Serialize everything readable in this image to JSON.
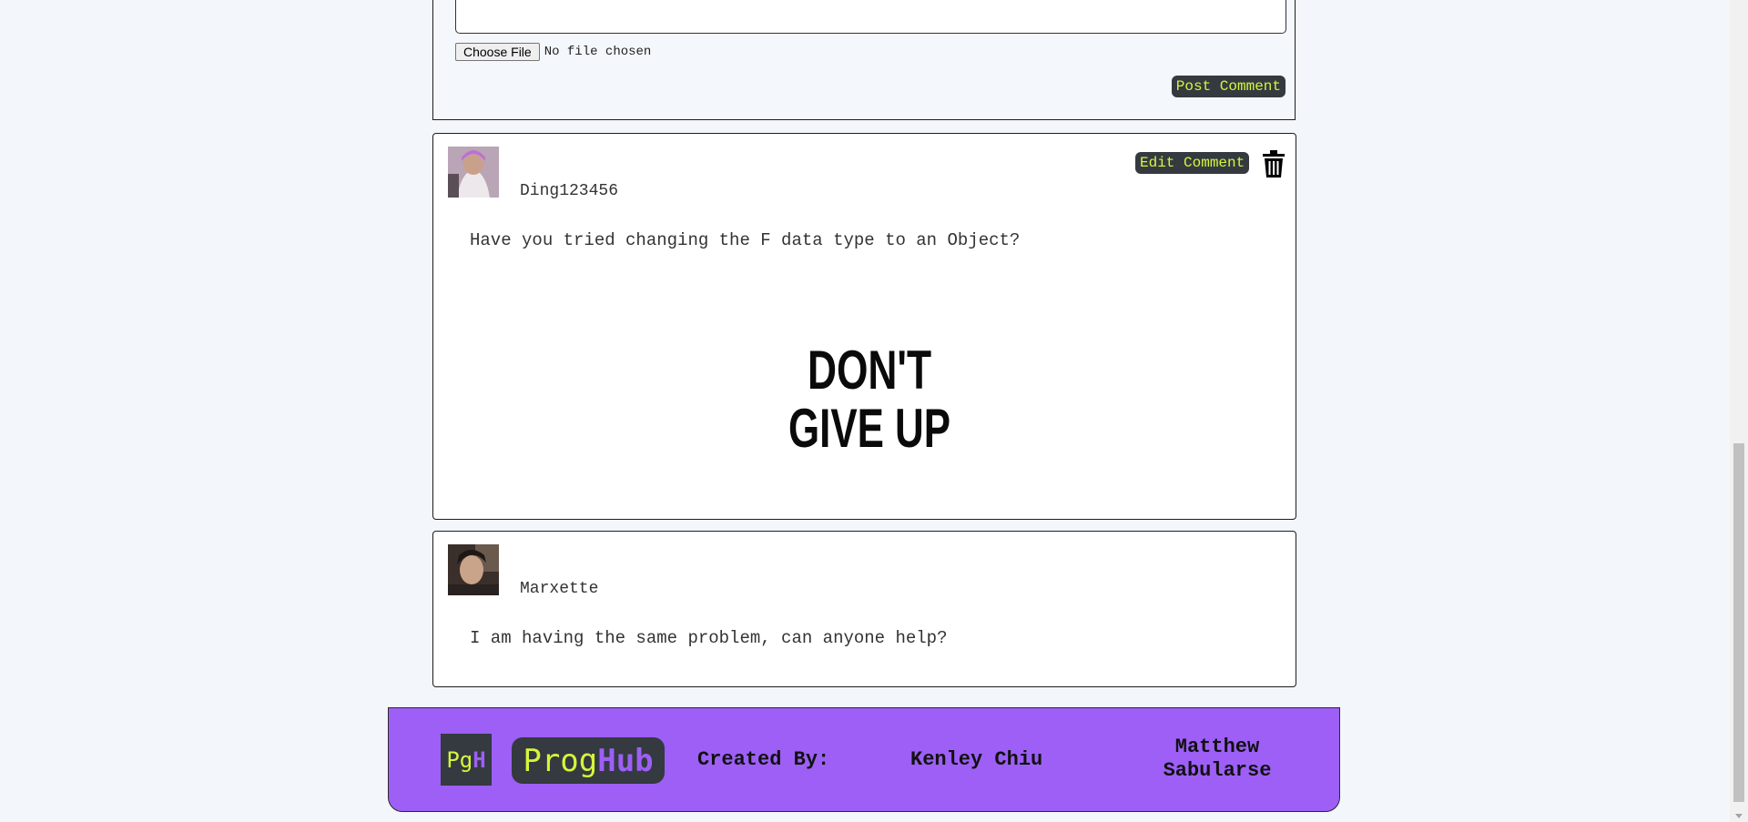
{
  "form": {
    "file_button": "Choose File",
    "file_status": "No file chosen",
    "post_button": "Post Comment"
  },
  "comments": [
    {
      "username": "Ding123456",
      "text": "Have you tried changing the F data type to an Object?",
      "edit_button": "Edit Comment",
      "image_text": [
        "DON'T",
        "GIVE UP"
      ]
    },
    {
      "username": "Marxette",
      "text": "I am having the same problem, can anyone help?"
    }
  ],
  "footer": {
    "logo_short_a": "Pg",
    "logo_short_b": "H",
    "logo_a": "Prog",
    "logo_b": "Hub",
    "created_by": "Created By:",
    "authors": [
      "Kenley Chiu",
      "Matthew Sabularse"
    ]
  },
  "colors": {
    "accent": "#9d5ff6",
    "button_bg": "#343a40",
    "button_text": "#d6f53a"
  },
  "icons": [
    "trash-icon"
  ]
}
